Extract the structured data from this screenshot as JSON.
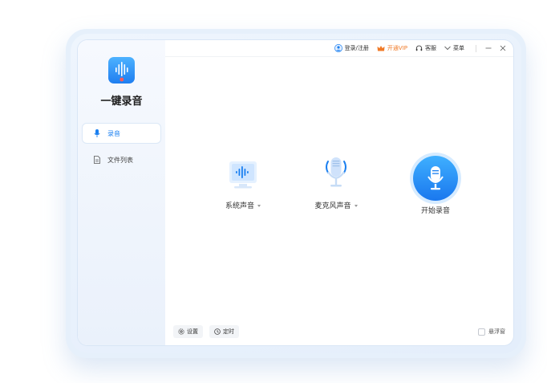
{
  "app": {
    "name": "一键录音"
  },
  "sidebar": {
    "items": [
      {
        "label": "录音",
        "icon": "microphone-icon",
        "active": true
      },
      {
        "label": "文件列表",
        "icon": "file-icon",
        "active": false
      }
    ]
  },
  "topbar": {
    "login": "登录/注册",
    "vip": "开通VIP",
    "service": "客服",
    "menu": "菜单"
  },
  "sources": [
    {
      "label": "系统声音",
      "icon": "monitor-waveform-icon",
      "has_dropdown": true
    },
    {
      "label": "麦克风声音",
      "icon": "microphone-waves-icon",
      "has_dropdown": true
    },
    {
      "label": "开始录音",
      "icon": "record-microphone-icon",
      "has_dropdown": false
    }
  ],
  "bottom": {
    "settings": "设置",
    "timer": "定时",
    "floating_window": "悬浮窗",
    "floating_window_checked": false
  },
  "colors": {
    "accent": "#1a7ff0",
    "vip": "#f07a28"
  }
}
